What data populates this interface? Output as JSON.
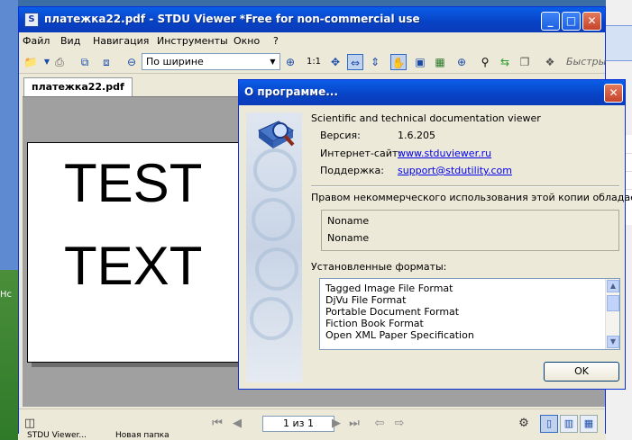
{
  "window": {
    "title": "платежка22.pdf - STDU Viewer *Free for non-commercial use",
    "minimize": "_",
    "maximize": "□",
    "close": "✕"
  },
  "menu": {
    "items": [
      "Файл",
      "Вид",
      "Навигация",
      "Инструменты",
      "Окно",
      "?"
    ]
  },
  "toolbar": {
    "zoom_mode": "По ширине",
    "zoom_ratio": "1:1",
    "quick_search_label": "Быстры"
  },
  "tabs": [
    {
      "label": "платежка22.pdf"
    }
  ],
  "document": {
    "line1": "TEST",
    "line2": "TEXT"
  },
  "statusbar": {
    "page_indicator": "1 из 1"
  },
  "taskbar": {
    "item1": "STDU Viewer...",
    "item2": "Новая папка"
  },
  "desktop": {
    "side_text": "Нс"
  },
  "about_dialog": {
    "title": "О программе...",
    "close": "✕",
    "product_desc": "Scientific and technical documentation viewer",
    "version_label": "Версия:",
    "version_value": "1.6.205",
    "site_label": "Интернет-сайт:",
    "site_value": "www.stduviewer.ru",
    "support_label": "Поддержка:",
    "support_value": "support@stdutility.com",
    "license_text": "Правом некоммерческого использования этой копии обладает:",
    "owner_name": "Noname",
    "owner_org": "Noname",
    "formats_label": "Установленные форматы:",
    "formats": [
      "Tagged Image File Format",
      "DjVu File Format",
      "Portable Document Format",
      "Fiction Book Format",
      "Open XML Paper Specification"
    ],
    "ok_label": "OK"
  },
  "colors": {
    "titlebar": "#0a5ee8",
    "link": "#0000ee",
    "viewer_bg": "#a0a0a0"
  }
}
